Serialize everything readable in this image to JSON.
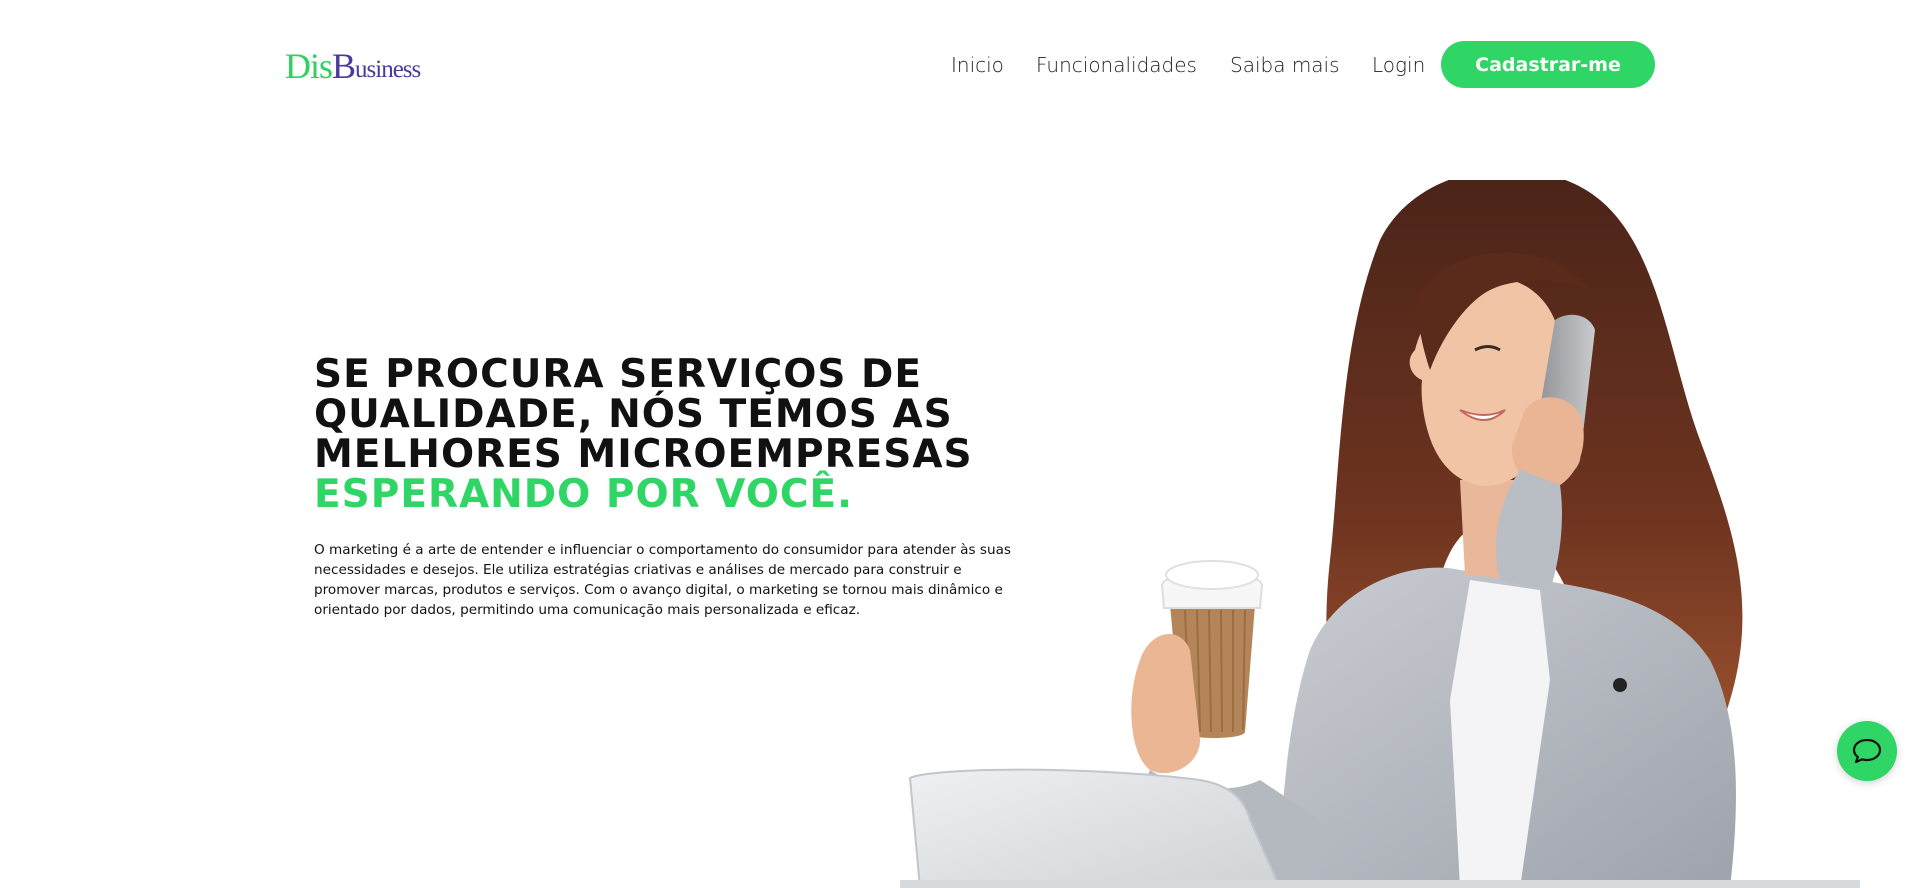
{
  "header": {
    "logo": {
      "part1": "Dis",
      "part2": "B",
      "part3": "usiness"
    },
    "nav": {
      "inicio": "Inicio",
      "funcionalidades": "Funcionalidades",
      "saiba_mais": "Saiba mais",
      "login": "Login",
      "signup_button": "Cadastrar-me"
    }
  },
  "hero": {
    "title_lines": [
      "SE PROCURA SERVIÇOS DE",
      "QUALIDADE, NÓS TEMOS AS",
      "MELHORES MICROEMPRESAS"
    ],
    "title_accent": "ESPERANDO POR VOCÊ.",
    "description": "O marketing é a arte de entender e influenciar o comportamento do consumidor para atender às suas necessidades e desejos. Ele utiliza estratégias criativas e análises de mercado para construir e promover marcas, produtos e serviços. Com o avanço digital, o marketing se tornou mais dinâmico e orientado por dados, permitindo uma comunicação mais personalizada e eficaz."
  },
  "icons": {
    "chat": "chat-bubble-icon"
  },
  "colors": {
    "accent_green": "#2fd565",
    "logo_purple": "#4b3a9c",
    "text_dark": "#111111"
  }
}
